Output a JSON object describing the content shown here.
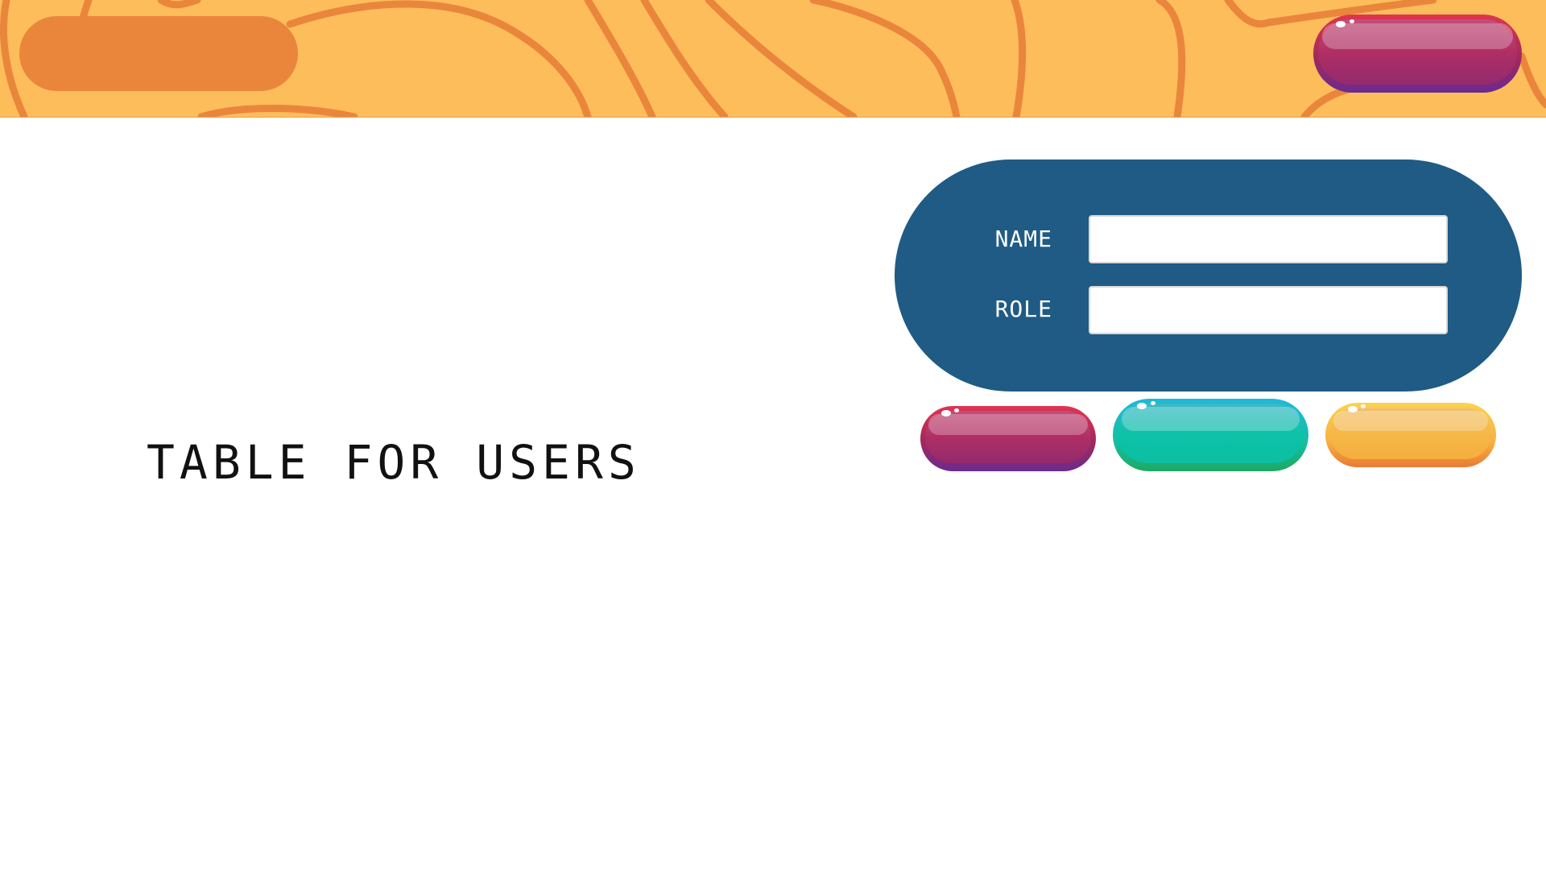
{
  "header": {
    "background_color": "#fdbd5b",
    "pattern_color": "#ea863c",
    "logo_pill_color": "#ea863c",
    "top_button_color": "magenta"
  },
  "main": {
    "title": "TABLE FOR USERS"
  },
  "form": {
    "panel_color": "#1f5b84",
    "name_label": "NAME",
    "name_value": "",
    "role_label": "ROLE",
    "role_value": ""
  },
  "actions": {
    "buttons": [
      {
        "color": "magenta"
      },
      {
        "color": "teal"
      },
      {
        "color": "yellow"
      }
    ]
  }
}
